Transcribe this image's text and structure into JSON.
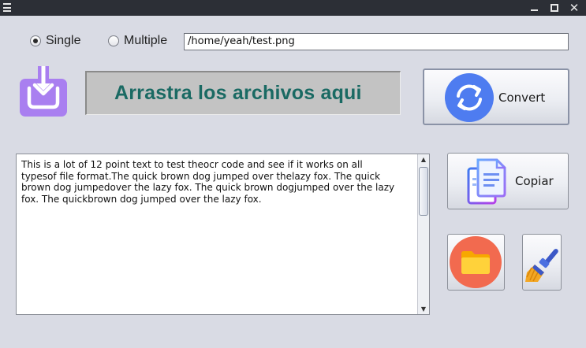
{
  "window": {
    "menu_icon": "hamburger-icon",
    "controls": {
      "minimize_icon": "minimize-icon",
      "maximize_icon": "maximize-icon",
      "close_icon": "close-icon",
      "close_glyph": "✕"
    }
  },
  "mode": {
    "options": [
      {
        "label": "Single",
        "checked": true
      },
      {
        "label": "Multiple",
        "checked": false
      }
    ]
  },
  "path_input": {
    "value": "/home/yeah/test.png"
  },
  "drop_zone": {
    "icon": "download-tray-icon",
    "icon_color": "#a97ff0",
    "text": "Arrastra los archivos aqui",
    "text_color": "#1a6a63"
  },
  "buttons": {
    "convert": {
      "label": "Convert",
      "icon": "sync-icon",
      "icon_color": "#4e7cf0"
    },
    "copy": {
      "label": "Copiar",
      "icon": "copy-documents-icon"
    },
    "folder": {
      "icon": "folder-icon",
      "icon_color": "#f26a4f"
    },
    "clear": {
      "icon": "broom-icon"
    }
  },
  "output_text": {
    "value": "This is a lot of 12 point text to test theocr code and see if it works on all\ntypesof file format.The quick brown dog jumped over thelazy fox. The quick\nbrown dog jumpedover the lazy fox. The quick brown dogjumped over the lazy\nfox. The quickbrown dog jumped over the lazy fox.",
    "scroll_up_glyph": "▲",
    "scroll_down_glyph": "▼"
  }
}
